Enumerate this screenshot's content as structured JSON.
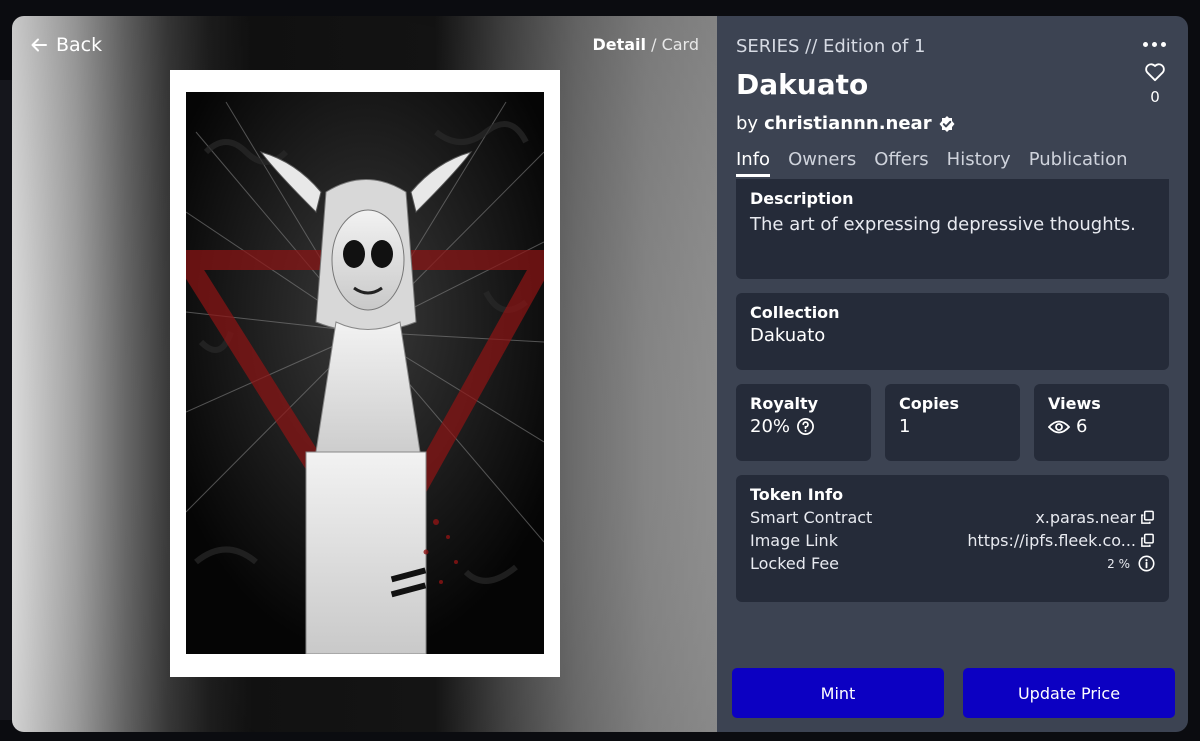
{
  "nav": {
    "back_label": "Back",
    "view_active": "Detail",
    "view_separator": "/",
    "view_inactive": "Card"
  },
  "token": {
    "series_line": "SERIES // Edition of 1",
    "title": "Dakuato",
    "by_prefix": "by",
    "creator": "christiannn.near",
    "like_count": "0"
  },
  "tabs": [
    {
      "label": "Info"
    },
    {
      "label": "Owners"
    },
    {
      "label": "Offers"
    },
    {
      "label": "History"
    },
    {
      "label": "Publication"
    }
  ],
  "description": {
    "title": "Description",
    "text": "The art of expressing depressive thoughts."
  },
  "collection": {
    "title": "Collection",
    "value": "Dakuato"
  },
  "stats": {
    "royalty": {
      "title": "Royalty",
      "value": "20%"
    },
    "copies": {
      "title": "Copies",
      "value": "1"
    },
    "views": {
      "title": "Views",
      "value": "6"
    }
  },
  "token_info": {
    "title": "Token Info",
    "rows": [
      {
        "label": "Smart Contract",
        "value": "x.paras.near"
      },
      {
        "label": "Image Link",
        "value": "https://ipfs.fleek.co..."
      },
      {
        "label": "Locked Fee",
        "value": "2 %"
      }
    ]
  },
  "actions": {
    "mint_label": "Mint",
    "update_price_label": "Update Price"
  },
  "colors": {
    "panel_bg": "#3c4352",
    "card_bg": "#252b39",
    "button_bg": "#0c00c2"
  },
  "icons": [
    "arrow-left-icon",
    "more-dots-icon",
    "heart-icon",
    "verified-badge-icon",
    "help-circle-icon",
    "eye-icon",
    "copy-icon",
    "info-circle-icon"
  ]
}
